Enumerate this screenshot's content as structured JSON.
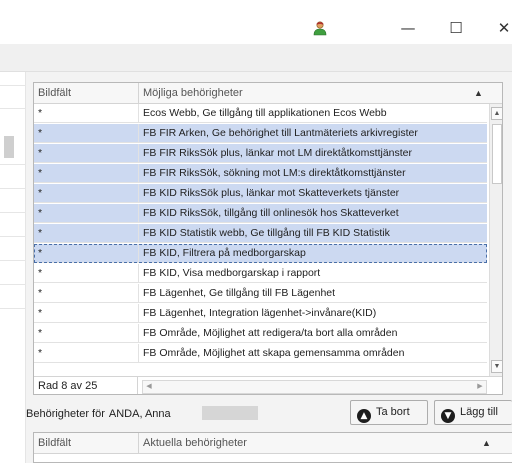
{
  "window": {
    "icons": {
      "user": "user-icon",
      "minimize": "minimize-icon",
      "maximize": "maximize-icon",
      "close": "close-icon"
    },
    "minimize_glyph": "—",
    "maximize_glyph": "☐",
    "close_glyph": "✕"
  },
  "available_grid": {
    "columns": [
      "Bildfält",
      "Möjliga behörigheter"
    ],
    "sort_glyph": "▲",
    "rows": [
      {
        "bildfalt": "*",
        "behorighet": "Ecos Webb, Ge tillgång till applikationen Ecos Webb",
        "state": "normal"
      },
      {
        "bildfalt": "*",
        "behorighet": "FB FIR Arken, Ge behörighet till Lantmäteriets arkivregister",
        "state": "selected"
      },
      {
        "bildfalt": "*",
        "behorighet": "FB FIR RiksSök plus, länkar mot LM direktåtkomsttjänster",
        "state": "selected"
      },
      {
        "bildfalt": "*",
        "behorighet": "FB FIR RiksSök, sökning mot LM:s direktåtkomsttjänster",
        "state": "selected"
      },
      {
        "bildfalt": "*",
        "behorighet": "FB KID RiksSök plus, länkar mot Skatteverkets tjänster",
        "state": "selected"
      },
      {
        "bildfalt": "*",
        "behorighet": "FB KID RiksSök, tillgång till onlinesök hos Skatteverket",
        "state": "selected"
      },
      {
        "bildfalt": "*",
        "behorighet": "FB KID Statistik webb, Ge tillgång till FB KID Statistik",
        "state": "selected"
      },
      {
        "bildfalt": "*",
        "behorighet": "FB KID, Filtrera på medborgarskap",
        "state": "current"
      },
      {
        "bildfalt": "*",
        "behorighet": "FB KID, Visa medborgarskap i rapport",
        "state": "normal"
      },
      {
        "bildfalt": "*",
        "behorighet": "FB Lägenhet, Ge tillgång till FB Lägenhet",
        "state": "normal"
      },
      {
        "bildfalt": "*",
        "behorighet": "FB Lägenhet, Integration lägenhet->invånare(KID)",
        "state": "normal"
      },
      {
        "bildfalt": "*",
        "behorighet": "FB Område, Möjlighet att redigera/ta bort alla områden",
        "state": "normal"
      },
      {
        "bildfalt": "*",
        "behorighet": "FB Område, Möjlighet att skapa gemensamma områden",
        "state": "normal"
      }
    ],
    "status": "Rad 8 av 25",
    "scroll_up": "▲",
    "scroll_down": "▼",
    "scroll_left": "◀",
    "scroll_right": "▶"
  },
  "owner": {
    "label": "Behörigheter för",
    "name": "ANDA, Anna"
  },
  "buttons": {
    "remove_label": "Ta bort",
    "add_label": "Lägg till",
    "remove_glyph": "▲",
    "add_glyph": "▼"
  },
  "current_grid": {
    "columns": [
      "Bildfält",
      "Aktuella behörigheter"
    ],
    "sort_glyph": "▲"
  }
}
